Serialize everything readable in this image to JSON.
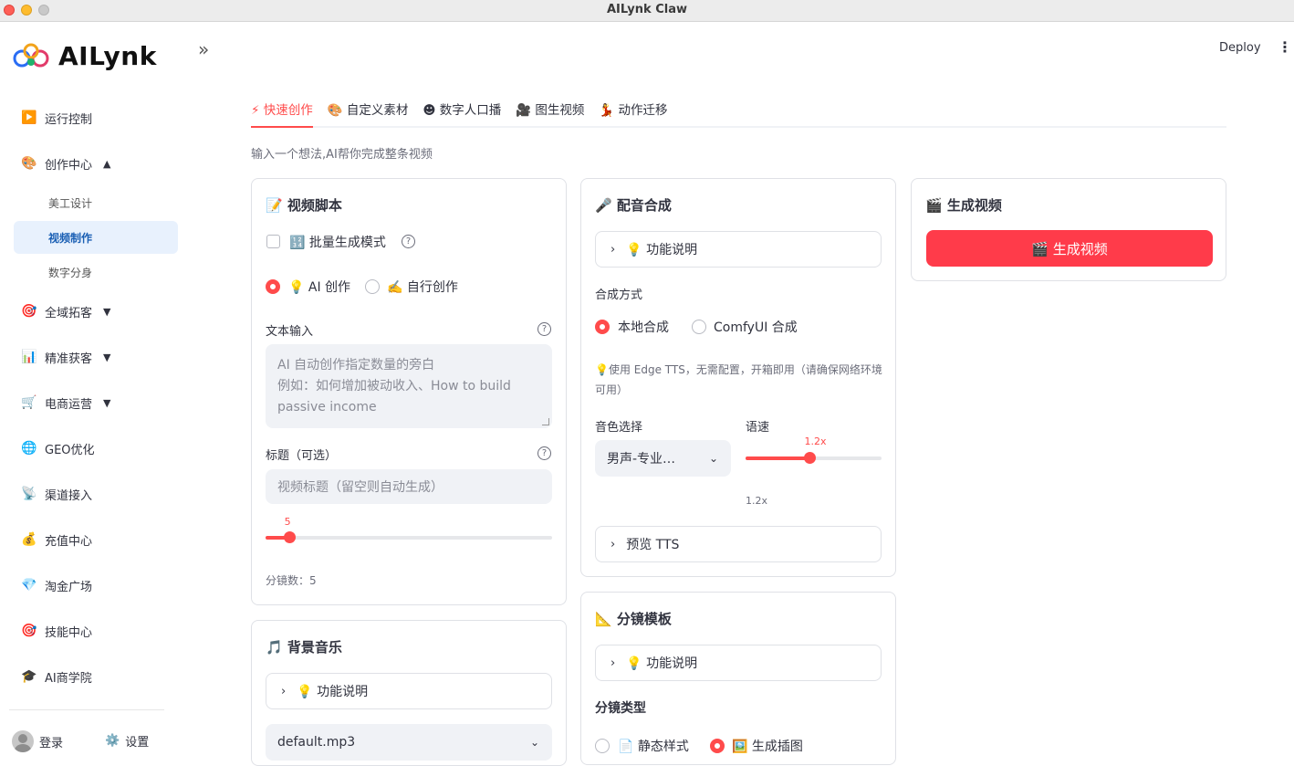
{
  "window": {
    "title": "AILynk Claw"
  },
  "brand": {
    "name": "AILynk"
  },
  "topbar": {
    "deploy": "Deploy",
    "menu": "⋮"
  },
  "sidebar": {
    "collapse": "»",
    "items": [
      {
        "icon": "▶️",
        "label": "运行控制"
      },
      {
        "icon": "🎨",
        "label": "创作中心",
        "arrow": "▲"
      },
      {
        "icon": "🎯",
        "label": "全域拓客",
        "arrow": "▼"
      },
      {
        "icon": "📊",
        "label": "精准获客",
        "arrow": "▼"
      },
      {
        "icon": "🛒",
        "label": "电商运营",
        "arrow": "▼"
      },
      {
        "icon": "🌐",
        "label": "GEO优化"
      },
      {
        "icon": "📡",
        "label": "渠道接入"
      },
      {
        "icon": "💰",
        "label": "充值中心"
      },
      {
        "icon": "💎",
        "label": "淘金广场"
      },
      {
        "icon": "🎯",
        "label": "技能中心"
      },
      {
        "icon": "🎓",
        "label": "AI商学院"
      }
    ],
    "subitems": [
      "美工设计",
      "视频制作",
      "数字分身"
    ],
    "footer": {
      "login": "登录",
      "settings": "设置",
      "settings_icon": "⚙️"
    }
  },
  "tabs": [
    {
      "label": "⚡ 快速创作"
    },
    {
      "label": "🎨 自定义素材"
    },
    {
      "label": "☻ 数字人口播"
    },
    {
      "label": "🎥 图生视频"
    },
    {
      "label": "💃 动作迁移"
    }
  ],
  "subtitle": "输入一个想法,AI帮你完成整条视频",
  "script_card": {
    "title": "📝 视频脚本",
    "batch_mode": "🔢 批量生成模式",
    "help": "?",
    "modes": [
      "💡 AI 创作",
      "✍️ 自行创作"
    ],
    "text_input_label": "文本输入",
    "text_input_placeholder": "AI 自动创作指定数量的旁白\n例如：如何增加被动收入、How to build passive income",
    "title_label": "标题（可选）",
    "title_placeholder": "视频标题（留空则自动生成）",
    "shots": {
      "value": 5,
      "min": 1,
      "max": 50
    },
    "shots_value_text": "5",
    "shots_note": "分镜数：",
    "shots_note_value": "5"
  },
  "music_card": {
    "title": "🎵 背景音乐",
    "help_expander": "💡 功能说明",
    "track": "default.mp3"
  },
  "voice_card": {
    "title": "🎤 配音合成",
    "help_expander": "💡 功能说明",
    "method_label": "合成方式",
    "methods": [
      "本地合成",
      "ComfyUI 合成"
    ],
    "note": "💡使用 Edge TTS，无需配置，开箱即用（请确保网络环境可用）",
    "voice_label": "音色选择",
    "voice_value": "男声-专业…",
    "speed_label": "语速",
    "speed": {
      "value": 1.2,
      "min": 0.5,
      "max": 2.0
    },
    "speed_text": "1.2x",
    "speed_note": "1.2x",
    "preview_expander": "预览 TTS"
  },
  "storyboard_card": {
    "title": "📐 分镜模板",
    "help_expander": "💡 功能说明",
    "type_label": "分镜类型",
    "types": [
      "📄 静态样式",
      "🖼️ 生成插图"
    ]
  },
  "generate_card": {
    "title": "🎬 生成视频",
    "button": "🎬 生成视频"
  },
  "colors": {
    "accent": "#ff4b4b",
    "button": "#ff3b4a",
    "active_nav_bg": "#e8f1fd"
  },
  "icons": {
    "chevron": "chevron-right-icon",
    "dropdown": "chevron-down-icon"
  }
}
